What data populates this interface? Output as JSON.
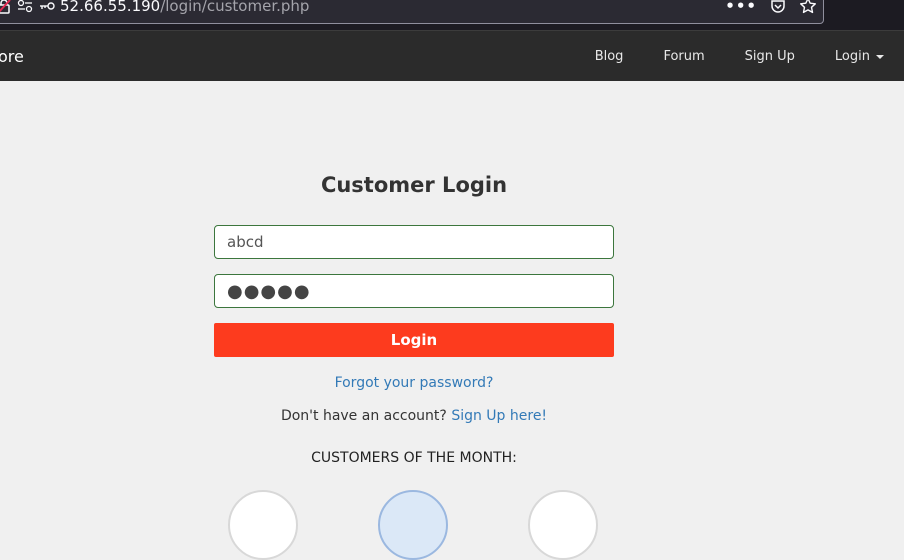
{
  "browser": {
    "url_host": "52.66.55.190",
    "url_path": "/login/customer.php",
    "menu_glyph": "•••"
  },
  "navbar": {
    "brand": "ore",
    "links": [
      "Blog",
      "Forum",
      "Sign Up"
    ],
    "login_label": "Login"
  },
  "login": {
    "title": "Customer Login",
    "username_value": "abcd",
    "password_mask": "●●●●●",
    "button_label": "Login",
    "forgot_label": "Forgot your password?",
    "signup_prompt": "Don't have an account? ",
    "signup_link": "Sign Up here!"
  },
  "customers": {
    "heading": "CUSTOMERS OF THE MONTH:"
  },
  "colors": {
    "navbar_bg": "#2b2b2b",
    "accent_button": "#fd3b1e",
    "link": "#337ab7",
    "input_border": "#3c763d"
  }
}
